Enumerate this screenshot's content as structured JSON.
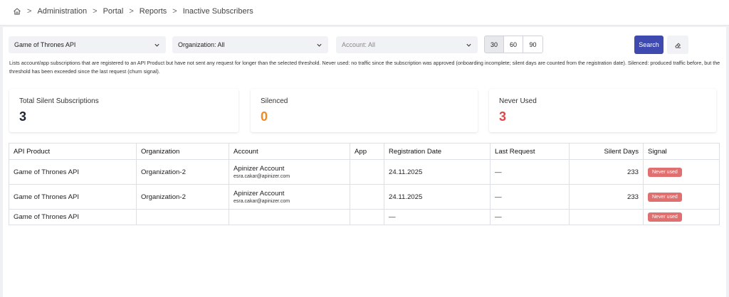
{
  "breadcrumb": {
    "items": [
      "Administration",
      "Portal",
      "Reports",
      "Inactive Subscribers"
    ]
  },
  "filters": {
    "api_product": "Game of Thrones API",
    "organization": "Organization: All",
    "account": "Account: All",
    "threshold_options": [
      "30",
      "60",
      "90"
    ],
    "threshold_selected": "30",
    "search_label": "Search"
  },
  "description": "Lists account/app subscriptions that are registered to an API Product but have not sent any request for longer than the selected threshold. Never used: no traffic since the subscription was approved (onboarding incomplete; silent days are counted from the registration date). Silenced: produced traffic before, but the threshold has been exceeded since the last request (churn signal).",
  "stats": {
    "total": {
      "label": "Total Silent Subscriptions",
      "value": "3",
      "color": "#1f2433"
    },
    "silenced": {
      "label": "Silenced",
      "value": "0",
      "color": "#f08a24"
    },
    "never_used": {
      "label": "Never Used",
      "value": "3",
      "color": "#e0454a"
    }
  },
  "table": {
    "headers": [
      "API Product",
      "Organization",
      "Account",
      "App",
      "Registration Date",
      "Last Request",
      "Silent Days",
      "Signal"
    ],
    "rows": [
      {
        "api_product": "Game of Thrones API",
        "organization": "Organization-2",
        "account": "Apinizer Account",
        "email": "esra.cakar@apinizer.com",
        "app": "",
        "registration_date": "24.11.2025",
        "last_request": "—",
        "silent_days": "233",
        "signal": "Never used"
      },
      {
        "api_product": "Game of Thrones API",
        "organization": "Organization-2",
        "account": "Apinizer Account",
        "email": "esra.cakar@apinizer.com",
        "app": "",
        "registration_date": "24.11.2025",
        "last_request": "—",
        "silent_days": "233",
        "signal": "Never used"
      },
      {
        "api_product": "Game of Thrones API",
        "organization": "",
        "account": "",
        "email": "",
        "app": "",
        "registration_date": "—",
        "last_request": "—",
        "silent_days": "",
        "signal": "Never used"
      }
    ]
  },
  "icons": {
    "home": "home-icon",
    "chevron": "chevron-down-icon",
    "eraser": "eraser-icon"
  },
  "colors": {
    "primary": "#3f4ab1",
    "badge": "#e07070"
  }
}
